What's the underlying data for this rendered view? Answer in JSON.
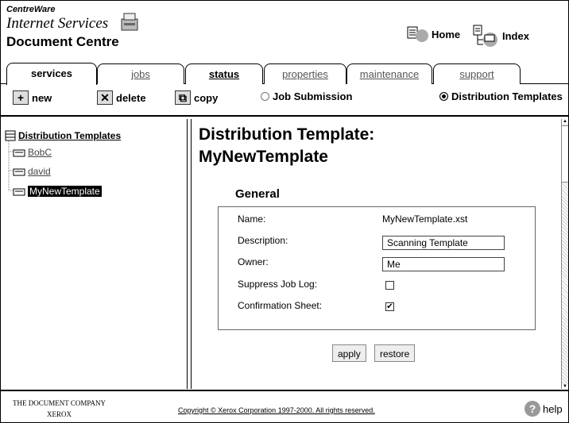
{
  "header": {
    "brand_top": "CentreWare",
    "brand_mid": "Internet Services",
    "brand_title": "Document Centre",
    "nav": {
      "home": "Home",
      "index": "Index"
    }
  },
  "tabs": [
    {
      "label": "services",
      "active": true
    },
    {
      "label": "jobs"
    },
    {
      "label": "status"
    },
    {
      "label": "properties"
    },
    {
      "label": "maintenance"
    },
    {
      "label": "support"
    }
  ],
  "toolbar": {
    "new": "new",
    "delete": "delete",
    "copy": "copy",
    "job_submission": "Job Submission",
    "distribution_templates": "Distribution Templates"
  },
  "tree": {
    "root": "Distribution Templates",
    "items": [
      "BobC",
      "david",
      "MyNewTemplate"
    ]
  },
  "main": {
    "title_line1": "Distribution Template:",
    "title_line2": "MyNewTemplate",
    "section": "General",
    "fields": {
      "name_label": "Name:",
      "name_value": "MyNewTemplate.xst",
      "description_label": "Description:",
      "description_value": "Scanning Template",
      "owner_label": "Owner:",
      "owner_value": "Me",
      "suppress_label": "Suppress Job Log:",
      "suppress_checked": false,
      "confirmation_label": "Confirmation Sheet:",
      "confirmation_checked": true
    },
    "buttons": {
      "apply": "apply",
      "restore": "restore"
    }
  },
  "footer": {
    "company_line1": "THE DOCUMENT COMPANY",
    "company_line2": "XEROX",
    "copyright": "Copyright © Xerox Corporation 1997-2000. All rights reserved.",
    "help": "help"
  }
}
